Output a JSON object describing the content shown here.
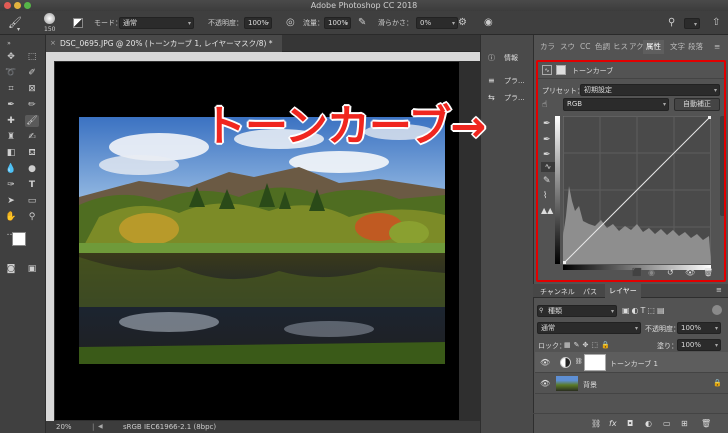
{
  "app": {
    "title": "Adobe Photoshop CC 2018"
  },
  "options_bar": {
    "brush_size": "150",
    "mode_label": "モード：",
    "mode_value": "通常",
    "opacity_label": "不透明度：",
    "opacity_value": "100%",
    "flow_label": "流量：",
    "flow_value": "100%",
    "smoothing_label": "滑らかさ：",
    "smoothing_value": "0%"
  },
  "document": {
    "tab_title": "DSC_0695.JPG @ 20% (トーンカーブ 1, レイヤーマスク/8) *",
    "zoom": "20%",
    "color_profile": "sRGB IEC61966-2.1 (8bpc)"
  },
  "collapsed_panels": {
    "info": "情報",
    "preset1": "プラ...",
    "preset2": "プラ..."
  },
  "properties_panel": {
    "tabs": [
      "カラ",
      "スウ",
      "CC",
      "色調",
      "ヒス",
      "アク",
      "属性",
      "文字",
      "段落"
    ],
    "active_tab": "属性",
    "header": "トーンカーブ",
    "preset_label": "プリセット：",
    "preset_value": "初期設定",
    "channel": "RGB",
    "auto_button": "自動補正"
  },
  "annotation": {
    "text": "トーンカーブ→",
    "color": "#f0261f"
  },
  "layers_panel": {
    "tabs": [
      "チャンネル",
      "パス",
      "レイヤー"
    ],
    "active_tab": "レイヤー",
    "filter_kind": "種類",
    "blend_mode": "通常",
    "opacity_label": "不透明度：",
    "opacity_value": "100%",
    "lock_label": "ロック：",
    "fill_label": "塗り：",
    "fill_value": "100%",
    "layers": [
      {
        "name": "トーンカーブ 1",
        "type": "adjustment"
      },
      {
        "name": "背景",
        "type": "image",
        "locked": true
      }
    ]
  },
  "colors": {
    "highlight_box": "#e10000"
  }
}
